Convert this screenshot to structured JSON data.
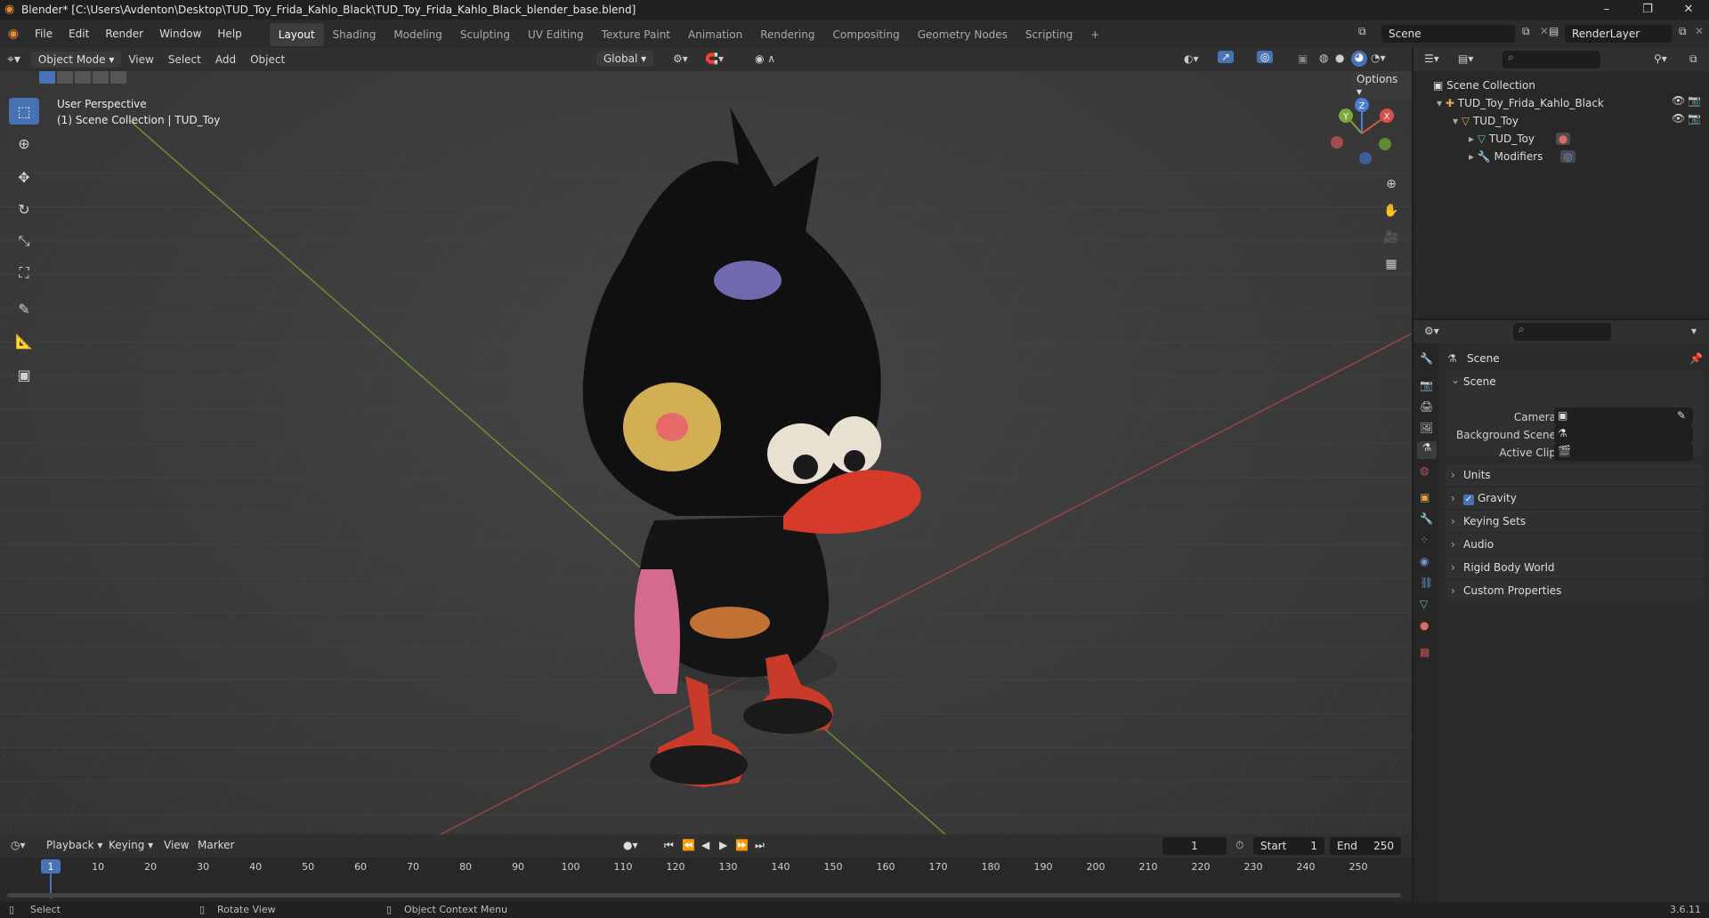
{
  "window": {
    "title": "Blender* [C:\\Users\\Avdenton\\Desktop\\TUD_Toy_Frida_Kahlo_Black\\TUD_Toy_Frida_Kahlo_Black_blender_base.blend]",
    "controls": [
      "–",
      "❐",
      "✕"
    ]
  },
  "menu": [
    "File",
    "Edit",
    "Render",
    "Window",
    "Help"
  ],
  "workspaces": [
    "Layout",
    "Shading",
    "Modeling",
    "Sculpting",
    "UV Editing",
    "Texture Paint",
    "Animation",
    "Rendering",
    "Compositing",
    "Geometry Nodes",
    "Scripting"
  ],
  "active_workspace": "Layout",
  "add_workspace": "+",
  "scene_selector": "Scene",
  "render_layer": "RenderLayer",
  "viewport_header": {
    "mode": "Object Mode",
    "menus": [
      "View",
      "Select",
      "Add",
      "Object"
    ],
    "transform_orientation": "Global",
    "options": "Options"
  },
  "viewport": {
    "perspective_label": "User Perspective",
    "collection_label": "(1) Scene Collection | TUD_Toy",
    "gizmo": {
      "x": "X",
      "y": "Y",
      "z": "Z"
    },
    "colors": {
      "x_axis": "#9a4447",
      "y_axis": "#6c8c34"
    }
  },
  "outliner": {
    "root": "Scene Collection",
    "items": [
      {
        "label": "TUD_Toy_Frida_Kahlo_Black",
        "depth": 1
      },
      {
        "label": "TUD_Toy",
        "depth": 2
      },
      {
        "label": "TUD_Toy",
        "depth": 3
      },
      {
        "label": "Modifiers",
        "depth": 3
      }
    ]
  },
  "properties": {
    "context": "Scene",
    "section": "Scene",
    "fields": [
      {
        "label": "Camera"
      },
      {
        "label": "Background Scene"
      },
      {
        "label": "Active Clip"
      }
    ],
    "panels": [
      "Units",
      "Gravity",
      "Keying Sets",
      "Audio",
      "Rigid Body World",
      "Custom Properties"
    ],
    "gravity_checked": true
  },
  "timeline": {
    "menus": [
      "Playback",
      "Keying",
      "View",
      "Marker"
    ],
    "current_frame": "1",
    "start_label": "Start",
    "start": "1",
    "end_label": "End",
    "end": "250",
    "ticks": [
      "1",
      "10",
      "20",
      "30",
      "40",
      "50",
      "60",
      "70",
      "80",
      "90",
      "100",
      "110",
      "120",
      "130",
      "140",
      "150",
      "160",
      "170",
      "180",
      "190",
      "200",
      "210",
      "220",
      "230",
      "240",
      "250"
    ]
  },
  "statusbar": {
    "select": "Select",
    "rotate": "Rotate View",
    "context_menu": "Object Context Menu",
    "version": "3.6.11"
  },
  "accent": "#4772b3"
}
